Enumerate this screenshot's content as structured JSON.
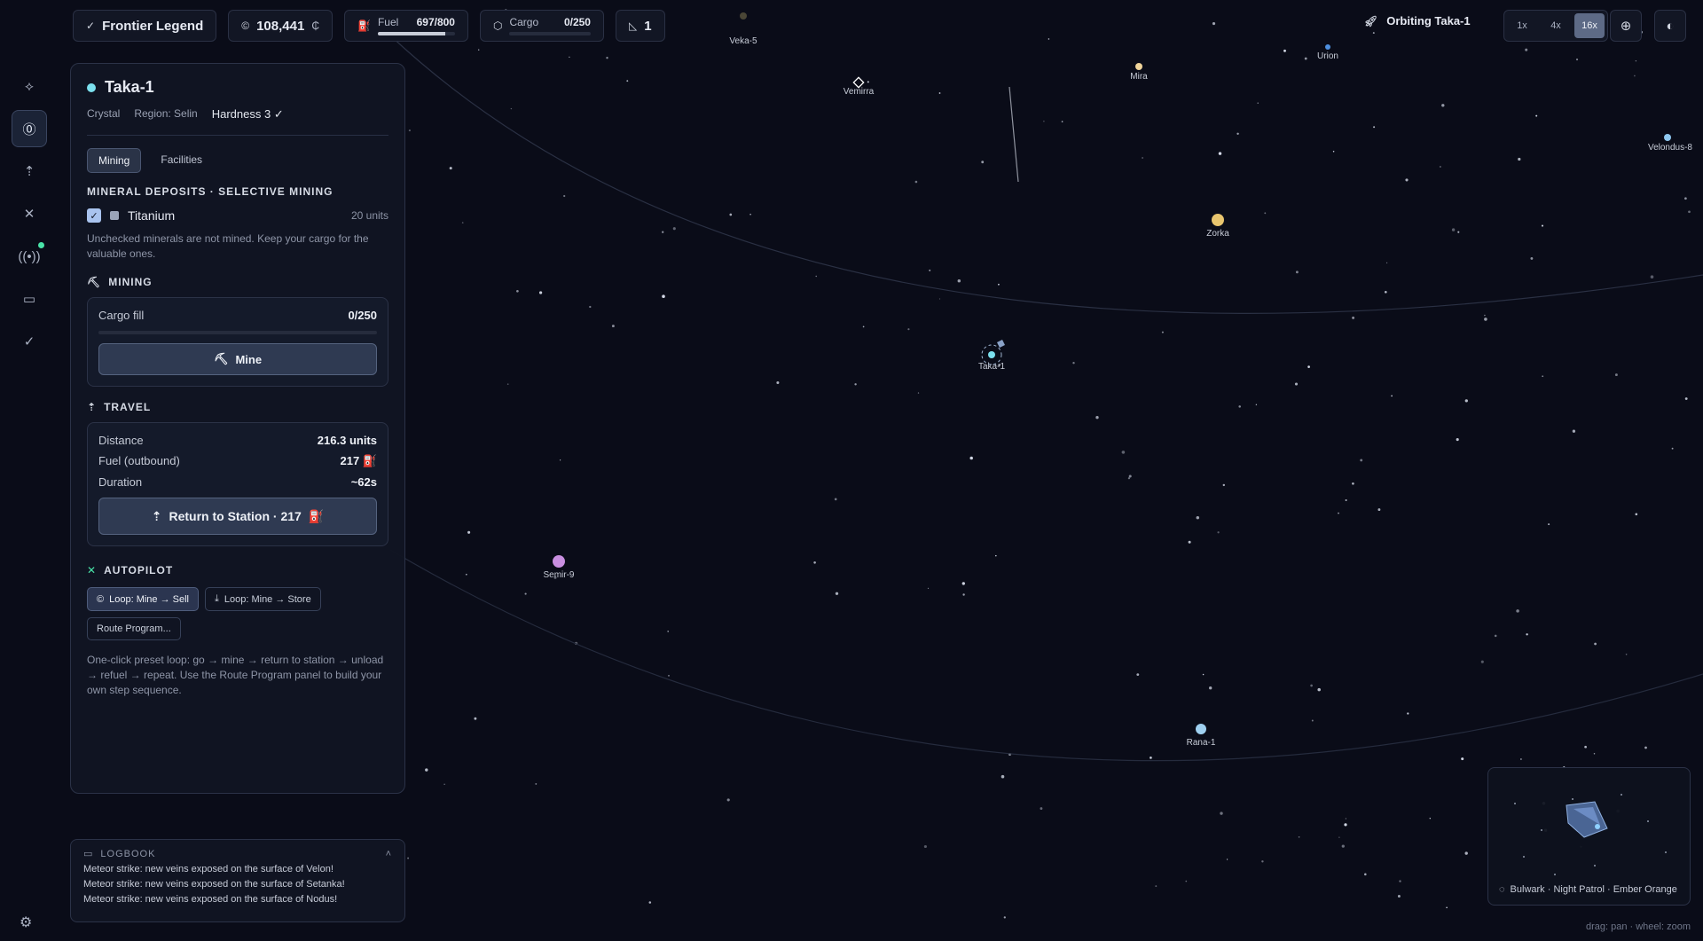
{
  "topbar": {
    "title": "Frontier Legend",
    "credits": "108,441",
    "credits_unit": "₵",
    "fuel_label": "Fuel",
    "fuel_value": "697/800",
    "fuel_fraction": 0.87,
    "cargo_label": "Cargo",
    "cargo_value": "0/250",
    "cargo_fraction": 0,
    "level": "1"
  },
  "status": {
    "orbit_text": "Orbiting Taka-1",
    "zoom_options": [
      "1x",
      "4x",
      "16x"
    ],
    "zoom_selected": "16x"
  },
  "panel": {
    "title": "Taka-1",
    "type": "Crystal",
    "region": "Region: Selin",
    "hardness": "Hardness 3",
    "tabs": [
      "Mining",
      "Facilities"
    ],
    "deposits_title": "MINERAL DEPOSITS · SELECTIVE MINING",
    "deposit_name": "Titanium",
    "deposit_units": "20 units",
    "deposit_note": "Unchecked minerals are not mined. Keep your cargo for the valuable ones.",
    "mining_title": "MINING",
    "cargo_fill_label": "Cargo fill",
    "cargo_fill_value": "0/250",
    "mine_button": "Mine",
    "travel_title": "TRAVEL",
    "distance_label": "Distance",
    "distance_value": "216.3 units",
    "fuel_label": "Fuel (outbound)",
    "fuel_value": "217",
    "duration_label": "Duration",
    "duration_value": "~62s",
    "return_button": "Return to Station · 217",
    "autopilot_title": "AUTOPILOT",
    "loop_sell": "Loop: Mine → Sell",
    "loop_store": "Loop: Mine → Store",
    "route_program": "Route Program...",
    "autopilot_note": "One-click preset loop: go → mine → return to station → unload → refuel → repeat. Use the Route Program panel to build your own step sequence."
  },
  "logbook": {
    "title": "LOGBOOK",
    "entries": [
      "Meteor strike: new veins exposed on the surface of Velon!",
      "Meteor strike: new veins exposed on the surface of Setanka!",
      "Meteor strike: new veins exposed on the surface of Nodus!"
    ]
  },
  "ship": {
    "name": "Bulwark · Night Patrol · Ember Orange"
  },
  "hint": "drag: pan · wheel: zoom",
  "map": {
    "bodies": [
      {
        "name": "Veka-5",
        "color": "#4a4636"
      },
      {
        "name": "Vemirra",
        "color": "#ffffff"
      },
      {
        "name": "Mira",
        "color": "#f0d49a"
      },
      {
        "name": "Urion",
        "color": "#4d8fe0"
      },
      {
        "name": "Velondus-8",
        "color": "#8fc8f0"
      },
      {
        "name": "Zorka",
        "color": "#e8c56e"
      },
      {
        "name": "Taka-1",
        "color": "#7be0ee"
      },
      {
        "name": "Semir-9",
        "color": "#c98fe0"
      },
      {
        "name": "Rana-1",
        "color": "#9fd0f0"
      }
    ]
  }
}
